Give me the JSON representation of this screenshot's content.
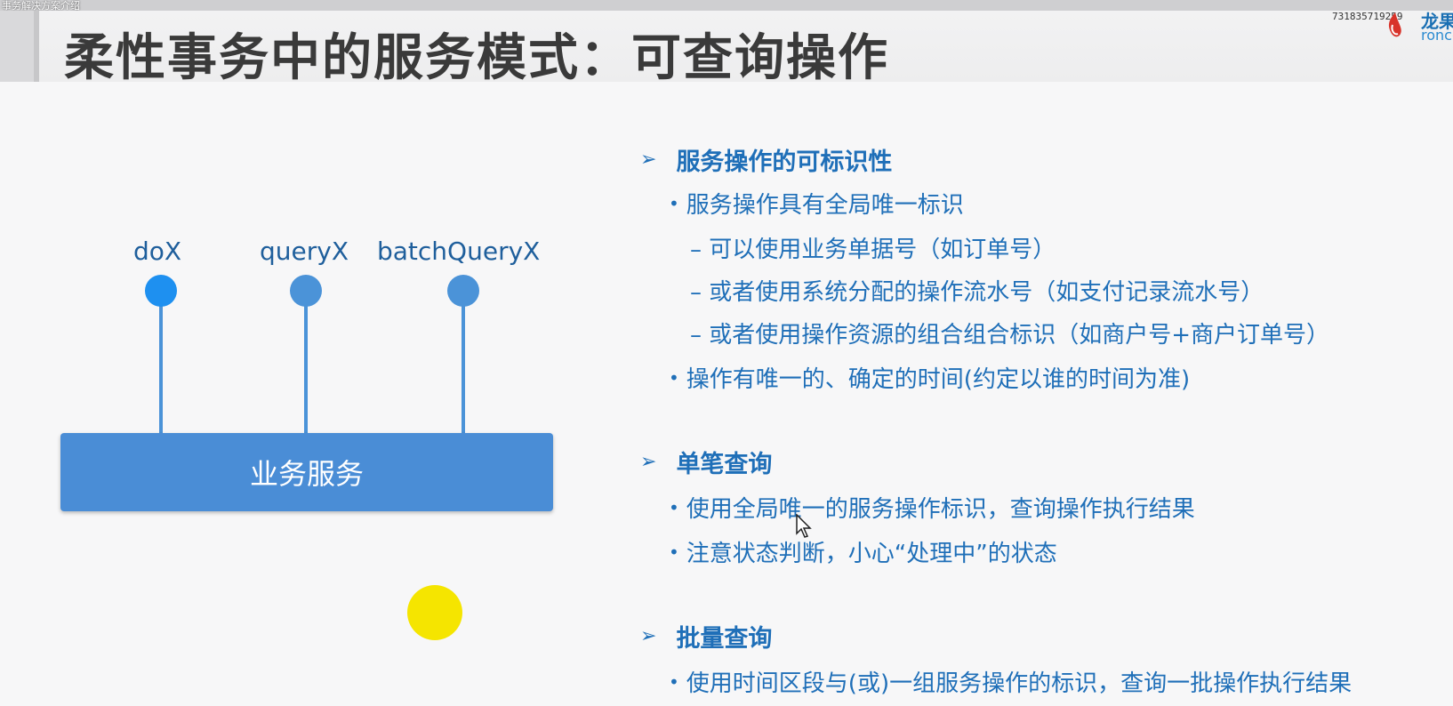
{
  "window": {
    "caption": "事务解决方案介绍",
    "watermark": "731835719259"
  },
  "logo": {
    "brand_cn": "龙果",
    "brand_en": "ronco"
  },
  "slide": {
    "title": "柔性事务中的服务模式：可查询操作"
  },
  "diagram": {
    "operations": [
      {
        "label": "doX",
        "color": "#1e90f0"
      },
      {
        "label": "queryX",
        "color": "#4b93d8"
      },
      {
        "label": "batchQueryX",
        "color": "#4b93d8"
      }
    ],
    "service_label": "业务服务"
  },
  "sections": [
    {
      "heading": "服务操作的可标识性",
      "items": [
        "服务操作具有全局唯一标识",
        "– 可以使用业务单据号（如订单号）",
        "– 或者使用系统分配的操作流水号（如支付记录流水号）",
        "– 或者使用操作资源的组合组合标识（如商户号+商户订单号）",
        "操作有唯一的、确定的时间(约定以谁的时间为准)"
      ]
    },
    {
      "heading": "单笔查询",
      "items": [
        "使用全局唯一的服务操作标识，查询操作执行结果",
        "注意状态判断，小心“处理中”的状态"
      ]
    },
    {
      "heading": "批量查询",
      "items": [
        "使用时间区段与(或)一组服务操作的标识，查询一批操作执行结果"
      ]
    }
  ],
  "colors": {
    "heading": "#1f6fb8",
    "service_box": "#4a8dd6",
    "highlight_dot": "#f5e500"
  }
}
